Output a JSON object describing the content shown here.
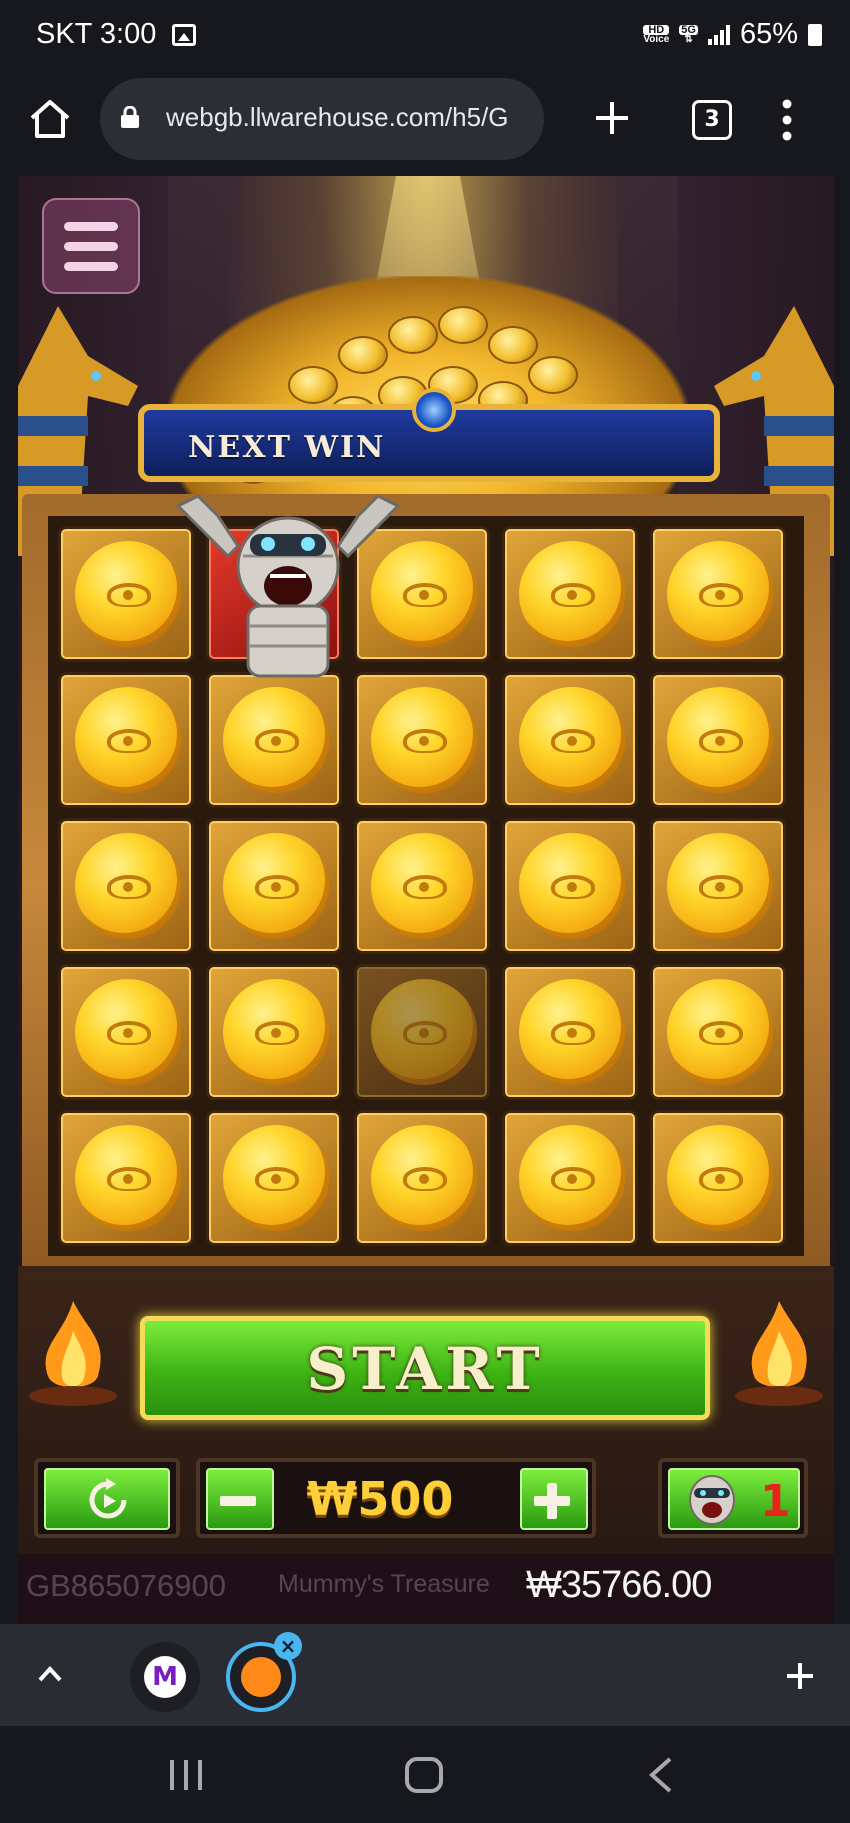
{
  "status": {
    "carrier_time": "SKT 3:00",
    "hd_label": "HD",
    "voice_label": "Voice",
    "network_label": "5G",
    "battery": "65%"
  },
  "browser": {
    "url": "webgb.llwarehouse.com/h5/G",
    "tab_count": "3"
  },
  "game": {
    "banner": "NEXT WIN",
    "start_label": "START",
    "bet": "₩500",
    "mummy_count": "1",
    "game_id": "GB865076900",
    "game_name": "Mummy's Treasure",
    "balance": "₩35766.00",
    "grid": {
      "rows": 5,
      "cols": 5,
      "revealed_tiles": [
        {
          "row": 1,
          "col": 2,
          "content": "mummy"
        }
      ],
      "dimmed_tiles": [
        {
          "row": 4,
          "col": 3
        }
      ]
    }
  },
  "tabbar": {
    "tab1_letter": "M",
    "close_glyph": "×"
  },
  "colors": {
    "start_green": "#3eb414",
    "coin_gold": "#ffd52a",
    "banner_blue": "#1f3a9e",
    "balance_text": "#f5f5f5"
  }
}
